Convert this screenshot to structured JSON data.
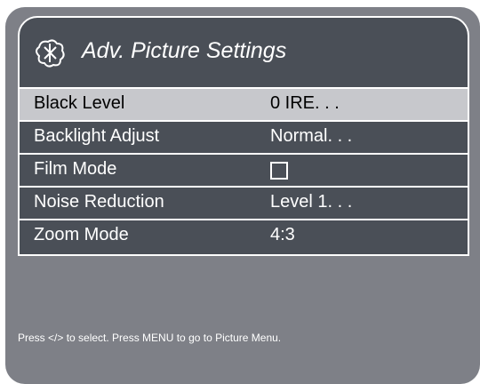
{
  "menu": {
    "title": "Adv. Picture Settings",
    "icon": "picture-settings-icon",
    "items": [
      {
        "label": "Black Level",
        "value": "0 IRE. . .",
        "type": "value",
        "selected": true
      },
      {
        "label": "Backlight Adjust",
        "value": "Normal. . .",
        "type": "value",
        "selected": false
      },
      {
        "label": "Film Mode",
        "value": "",
        "type": "checkbox",
        "checked": false,
        "selected": false
      },
      {
        "label": "Noise Reduction",
        "value": "Level 1. . .",
        "type": "value",
        "selected": false
      },
      {
        "label": "Zoom Mode",
        "value": "4:3",
        "type": "value",
        "selected": false
      }
    ]
  },
  "hint": "Press </> to select. Press MENU to go to Picture Menu.",
  "colors": {
    "background": "#7e8087",
    "menu_panel": "#4a4f57",
    "selected_row": "#c7c8cc",
    "text": "#ffffff"
  }
}
